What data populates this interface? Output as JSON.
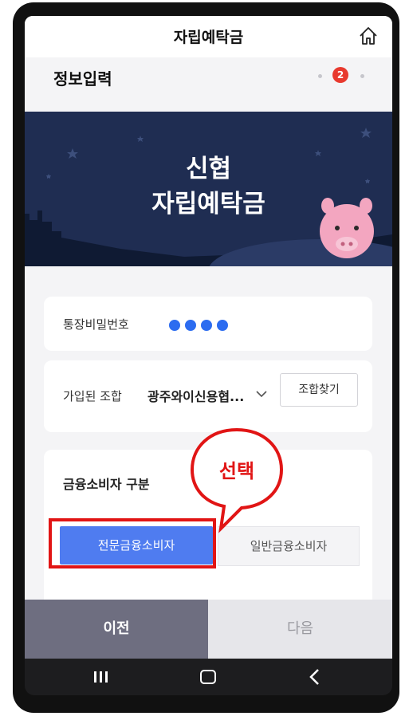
{
  "header": {
    "title": "자립예탁금",
    "home_icon": "home-icon"
  },
  "step": {
    "title": "정보입력",
    "current_step": "2",
    "total_steps": 3
  },
  "banner": {
    "line1": "신협",
    "line2": "자립예탁금",
    "background": "#1f2d52"
  },
  "password": {
    "label": "통장비밀번호",
    "filled_dots": 4
  },
  "union": {
    "label": "가입된 조합",
    "value": "광주와이신용협...",
    "find_button": "조합찾기"
  },
  "consumer": {
    "label": "금융소비자 구분",
    "option_professional": "전문금융소비자",
    "option_general": "일반금융소비자",
    "selected": "전문금융소비자"
  },
  "callout": {
    "text": "선택",
    "color": "#e11515"
  },
  "footer": {
    "prev_label": "이전",
    "next_label": "다음"
  },
  "navbar": {
    "recent_icon": "recent-apps-icon",
    "home_icon": "home-button-icon",
    "back_icon": "back-icon"
  },
  "colors": {
    "accent": "#4f7cf0",
    "badge": "#e8392e",
    "dots": "#2c6cf0"
  }
}
